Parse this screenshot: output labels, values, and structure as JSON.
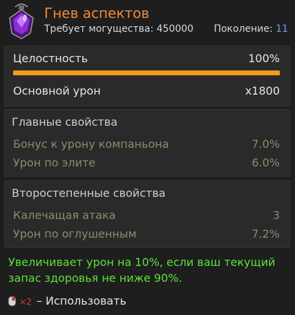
{
  "item": {
    "title": "Гнев аспектов",
    "power_requirement": "Требует могущества: 450000",
    "generation_label": "Поколение:",
    "generation_value": "11",
    "icon": "purple-gem-icon"
  },
  "stats": {
    "integrity_label": "Целостность",
    "integrity_value": "100%",
    "integrity_fraction": 1.0,
    "base_damage_label": "Основной урон",
    "base_damage_value": "x1800"
  },
  "main_properties": {
    "header": "Главные свойства",
    "items": [
      {
        "label": "Бонус к урону компаньона",
        "value": "7.0%"
      },
      {
        "label": "Урон по элите",
        "value": "6.0%"
      }
    ]
  },
  "secondary_properties": {
    "header": "Второстепенные свойства",
    "items": [
      {
        "label": "Калечащая атака",
        "value": "3"
      },
      {
        "label": "Урон по оглушенным",
        "value": "7.2%"
      }
    ]
  },
  "description": "Увеличивает урон на 10%, если ваш текущий запас здоровья не ниже 90%.",
  "usage": {
    "icon": "mouse-right-click-icon",
    "multiplier": "×2",
    "label": "– Использовать"
  },
  "colors": {
    "title": "#ee8a3a",
    "bar": "#f39b1e",
    "description": "#5de23f",
    "generation": "#6fa4e8",
    "property": "#8f8a6c"
  }
}
